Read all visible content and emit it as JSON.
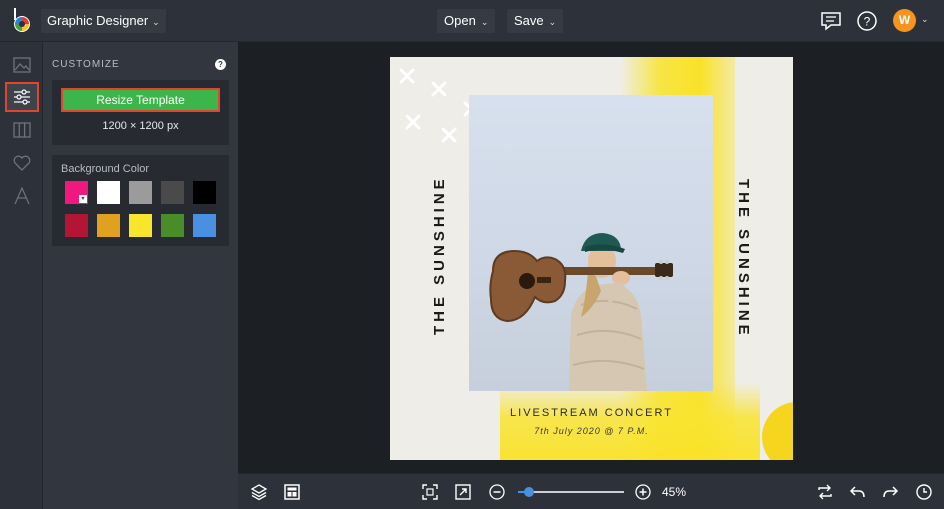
{
  "header": {
    "workspace_label": "Graphic Designer",
    "open_label": "Open",
    "save_label": "Save",
    "avatar_initial": "W"
  },
  "sidebar": {
    "items": [
      {
        "icon": "image-icon"
      },
      {
        "icon": "sliders-icon",
        "active": true
      },
      {
        "icon": "layout-icon"
      },
      {
        "icon": "heart-icon"
      },
      {
        "icon": "text-icon"
      }
    ]
  },
  "panel": {
    "title": "CUSTOMIZE",
    "resize_label": "Resize Template",
    "size_text": "1200 × 1200 px",
    "background_label": "Background Color",
    "swatches": [
      "#f0177e",
      "#ffffff",
      "#9b9b9b",
      "#4a4a4a",
      "#000000",
      "#b31634",
      "#e0a020",
      "#f7e62b",
      "#4a8c28",
      "#4a90e2"
    ]
  },
  "design": {
    "side_text_left": "THE SUNSHINE",
    "side_text_right": "THE SUNSHINE",
    "headline": "LIVESTREAM CONCERT",
    "subline": "7th July 2020 @ 7 P.M."
  },
  "toolbar": {
    "zoom_label": "45%",
    "zoom_level": 0.1
  },
  "colors": {
    "accent_green": "#3cb54a",
    "highlight_red": "#e2442f",
    "avatar_orange": "#f7941d",
    "paint_yellow": "#f9e23a"
  }
}
